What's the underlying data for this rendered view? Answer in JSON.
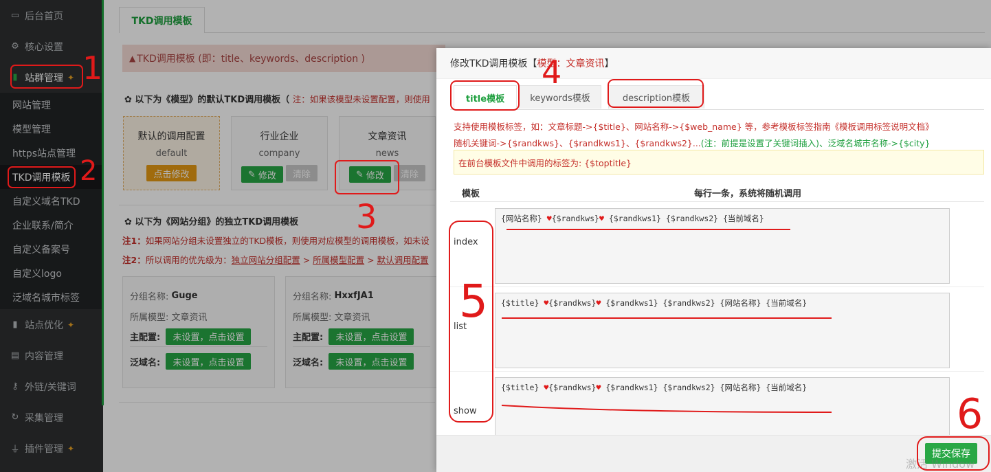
{
  "sidebar": {
    "items": [
      {
        "label": "后台首页",
        "icon": "monitor-icon"
      },
      {
        "label": "核心设置",
        "icon": "gear-icon"
      },
      {
        "label": "站群管理",
        "icon": "chart-icon"
      }
    ],
    "subitems": [
      "网站管理",
      "模型管理",
      "https站点管理",
      "TKD调用模板",
      "自定义域名TKD",
      "企业联系/简介",
      "自定义备案号",
      "自定义logo",
      "泛域名城市标签"
    ],
    "bottom_items": [
      {
        "label": "站点优化",
        "icon": "chart-icon"
      },
      {
        "label": "内容管理",
        "icon": "document-icon"
      },
      {
        "label": "外链/关键词",
        "icon": "key-icon"
      },
      {
        "label": "采集管理",
        "icon": "refresh-icon"
      },
      {
        "label": "插件管理",
        "icon": "plug-icon"
      }
    ]
  },
  "page": {
    "tab": "TKD调用模板",
    "alert": "TKD调用模板 (即：title、keywords、description )",
    "section1_title": "以下为《模型》的默认TKD调用模板（",
    "section1_note": "注：如果该模型未设置配置，则使用",
    "cards": [
      {
        "title": "默认的调用配置",
        "sub": "default",
        "btn": "点击修改"
      },
      {
        "title": "行业企业",
        "sub": "company",
        "btn": "修改",
        "btn2": "清除"
      },
      {
        "title": "文章资讯",
        "sub": "news",
        "btn": "修改",
        "btn2": "清除"
      }
    ],
    "section2_title": "以下为《网站分组》的独立TKD调用模板",
    "note1_label": "注1：",
    "note1": "如果网站分组未设置独立的TKD模板，则使用对应模型的调用模板，如未设",
    "note2_label": "注2：",
    "note2_pre": "所以调用的优先级为：",
    "note2_a": "独立网站分组配置",
    "note2_b": "所属模型配置",
    "note2_c": "默认调用配置",
    "groups": [
      {
        "name_label": "分组名称:",
        "name": "Guge",
        "model_label": "所属模型:",
        "model": "文章资讯",
        "main_label": "主配置:",
        "main_btn": "未设置，点击设置",
        "pan_label": "泛域名:",
        "pan_btn": "未设置，点击设置"
      },
      {
        "name_label": "分组名称:",
        "name": "HxxfJA1",
        "model_label": "所属模型:",
        "model": "文章资讯",
        "main_label": "主配置:",
        "main_btn": "未设置，点击设置",
        "pan_label": "泛域名:",
        "pan_btn": "未设置，点击设置"
      }
    ]
  },
  "modal": {
    "title_pre": "修改TKD调用模板【",
    "title_model": "模型：文章资讯",
    "title_post": "】",
    "tabs": [
      "title模板",
      "keywords模板",
      "description模板"
    ],
    "tip1": "支持使用模板标签，如：文章标题->{$title}、网站名称->{$web_name} 等，参考模板标签指南《模板调用标签说明文档》",
    "tip2a": "随机关键词->{$randkws}、{$randkws1}、{$randkws2}...",
    "tip2b": "(注：前提是设置了关键词插入)、泛域名城市名称->{$city}",
    "yellow": "在前台模板文件中调用的标签为: {$toptitle}",
    "col1": "模板",
    "col2": "每行一条，系统将随机调用",
    "rows": [
      {
        "label": "index",
        "p1": "{网站名称} ",
        "p2": "{$randkws}",
        "p3": " {$randkws1} {$randkws2} {当前域名}"
      },
      {
        "label": "list",
        "p1": "{$title} ",
        "p2": "{$randkws}",
        "p3": " {$randkws1} {$randkws2} {网站名称} {当前域名}"
      },
      {
        "label": "show",
        "p1": "{$title} ",
        "p2": "{$randkws}",
        "p3": " {$randkws1} {$randkws2} {网站名称} {当前域名}"
      }
    ],
    "save": "提交保存"
  },
  "annotations": [
    "1",
    "2",
    "3",
    "4",
    "5",
    "6"
  ],
  "watermark": "激活 Window",
  "colors": {
    "accent": "#1e9f3e",
    "red": "#c5302b",
    "annotation": "#e01a1a"
  }
}
